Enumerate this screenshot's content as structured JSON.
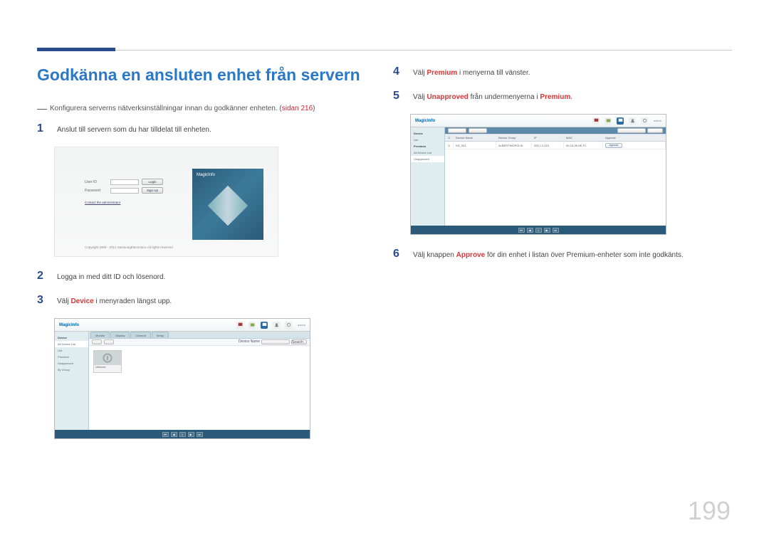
{
  "pageNumber": "199",
  "title": "Godkänna en ansluten enhet från servern",
  "note": {
    "prefix": "Konfigurera serverns nätverksinställningar innan du godkänner enheten. (",
    "link": "sidan 216",
    "suffix": ")"
  },
  "steps": {
    "s1": {
      "num": "1",
      "text": "Anslut till servern som du har tilldelat till enheten."
    },
    "s2": {
      "num": "2",
      "text": "Logga in med ditt ID och lösenord."
    },
    "s3": {
      "num": "3",
      "pre": "Välj ",
      "accent": "Device",
      "post": " i menyraden längst upp."
    },
    "s4": {
      "num": "4",
      "pre": "Välj ",
      "accent": "Premium",
      "post": " i menyerna till vänster."
    },
    "s5": {
      "num": "5",
      "pre": "Välj ",
      "accent": "Unapproved",
      "post_pre": " från undermenyerna i ",
      "accent2": "Premium",
      "post": "."
    },
    "s6": {
      "num": "6",
      "pre": "Välj knappen ",
      "accent": "Approve",
      "post": " för din enhet i listan över Premium-enheter som inte godkänts."
    }
  },
  "loginShot": {
    "userIdLabel": "User ID",
    "passwordLabel": "Password",
    "loginBtn": "Login",
    "signupBtn": "Sign Up",
    "contactLink": "Contact the administrator",
    "copyright": "Copyright 2009 - 2012 SamsungElectronics All rights reserved",
    "brand": "MagicInfo"
  },
  "appShot": {
    "brand": "MagicInfo",
    "user": "admin",
    "sidebar": {
      "device": "Device",
      "premium": "Premium",
      "allDeviceList": "All Device List",
      "unapproved": "Unapproved",
      "lite": "Lite",
      "byGroup": "By Group"
    },
    "tabs": {
      "monitor": "Monitor",
      "display": "Display",
      "general": "General",
      "setup": "Setup"
    },
    "searchLabel": "Device Name",
    "searchBtn": "Search",
    "card": "Unknown",
    "table": {
      "chk": "",
      "name": "Device Name",
      "group": "Device Group",
      "ip": "IP",
      "mac": "MAC",
      "approve": "Approve",
      "row": {
        "name": "DS_001",
        "group": "ALBERTINOPOLIS",
        "ip": "200.1.0.115",
        "mac": "00-15-99-5E-F1"
      }
    },
    "approveBtn": "Approve"
  }
}
